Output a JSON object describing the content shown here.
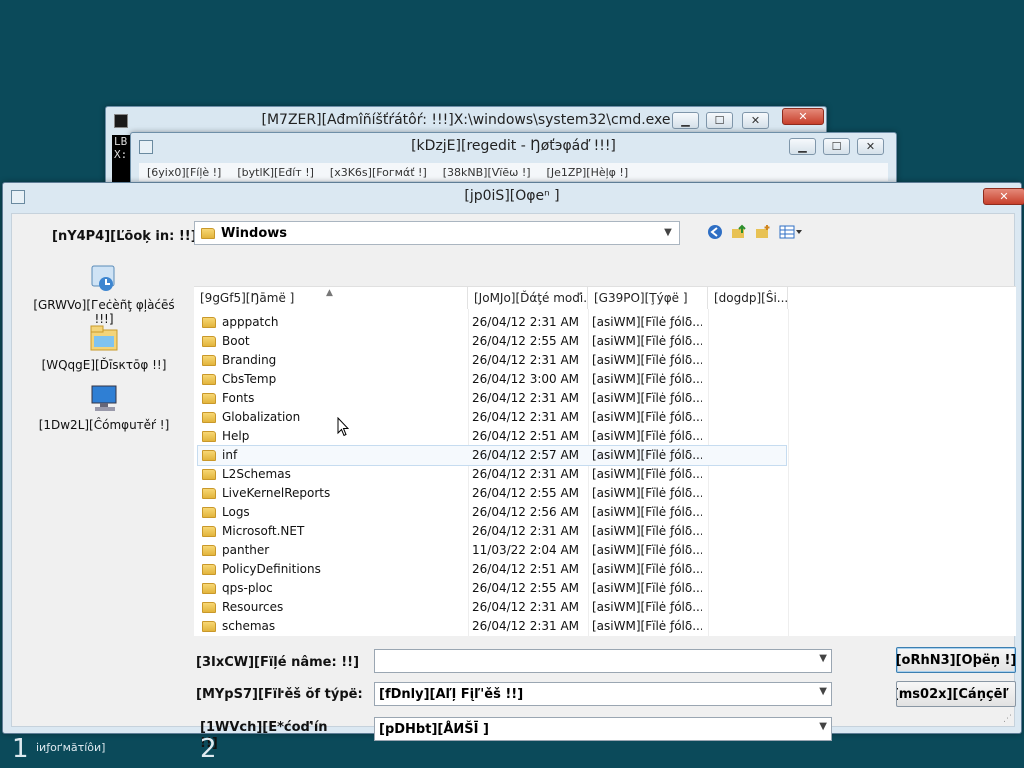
{
  "cmd_window": {
    "title": "[M7ZER][Ađmîñíšťŕátôŕ:  !!!]X:\\windows\\system32\\cmd.exe",
    "console_text": "LB\nX:"
  },
  "notepad_window": {
    "title": "[kDzjE][regedit - Ŋøťэφáď !!!]",
    "menus": [
      "[6yix0][Fíļè !]",
      "[bytlK][Eđíт !]",
      "[x3K6s][Foгмάť !]",
      "[38kNB][Vïēω !]",
      "[Je1ZP][Hèļφ !]"
    ]
  },
  "open_dialog": {
    "title": "[jp0iS][Öφeⁿ ]",
    "look_in_label": "[nY4P4][Ľōoķ in: !!]",
    "look_in_value": "Windows",
    "places": [
      "[GRWVo][Гeċèñţ φļàćēś !!!]",
      "[WQqgE][Ďīsкτōφ !!]",
      "[1Dw2L][Ĉómφuтěŕ !]"
    ],
    "columns": [
      "[9gGf5][Ŋāmë ]",
      "[JoMJo][Ďάţé moďi...",
      "[G39PO][Ţýφë ]",
      "[dogdp][Ŝi..."
    ],
    "files": [
      {
        "name": "apppatch",
        "date": "26/04/12 2:31 AM",
        "type": "[asiWM][Fïlė ƒólδ..."
      },
      {
        "name": "Boot",
        "date": "26/04/12 2:55 AM",
        "type": "[asiWM][Fïlė ƒólδ..."
      },
      {
        "name": "Branding",
        "date": "26/04/12 2:31 AM",
        "type": "[asiWM][Fïlė ƒólδ..."
      },
      {
        "name": "CbsTemp",
        "date": "26/04/12 3:00 AM",
        "type": "[asiWM][Fïlė ƒólδ..."
      },
      {
        "name": "Fonts",
        "date": "26/04/12 2:31 AM",
        "type": "[asiWM][Fïlė ƒólδ..."
      },
      {
        "name": "Globalization",
        "date": "26/04/12 2:31 AM",
        "type": "[asiWM][Fïlė ƒólδ..."
      },
      {
        "name": "Help",
        "date": "26/04/12 2:51 AM",
        "type": "[asiWM][Fïlė ƒólδ..."
      },
      {
        "name": "inf",
        "date": "26/04/12 2:57 AM",
        "type": "[asiWM][Fïlė ƒólδ..."
      },
      {
        "name": "L2Schemas",
        "date": "26/04/12 2:31 AM",
        "type": "[asiWM][Fïlė ƒólδ..."
      },
      {
        "name": "LiveKernelReports",
        "date": "26/04/12 2:55 AM",
        "type": "[asiWM][Fïlė ƒólδ..."
      },
      {
        "name": "Logs",
        "date": "26/04/12 2:56 AM",
        "type": "[asiWM][Fïlė ƒólδ..."
      },
      {
        "name": "Microsoft.NET",
        "date": "26/04/12 2:31 AM",
        "type": "[asiWM][Fïlė ƒólδ..."
      },
      {
        "name": "panther",
        "date": "11/03/22 2:04 AM",
        "type": "[asiWM][Fïlė ƒólδ..."
      },
      {
        "name": "PolicyDefinitions",
        "date": "26/04/12 2:51 AM",
        "type": "[asiWM][Fïlė ƒólδ..."
      },
      {
        "name": "qps-ploc",
        "date": "26/04/12 2:55 AM",
        "type": "[asiWM][Fïlė ƒólδ..."
      },
      {
        "name": "Resources",
        "date": "26/04/12 2:31 AM",
        "type": "[asiWM][Fïlė ƒólδ..."
      },
      {
        "name": "schemas",
        "date": "26/04/12 2:31 AM",
        "type": "[asiWM][Fïlė ƒólδ..."
      }
    ],
    "file_name_label": "[3IxCW][Fïļé nâme: !!]",
    "file_name_value": "",
    "file_type_label": "[MYpS7][Fïŀěš ŏf týpë:",
    "file_type_value": "[fDnly][Aľļ Fįľ'ěš  !!]",
    "encoding_label": "[1WVch][E*ćoď'ín\n!!]",
    "encoding_value": "[pDHbt][ÅИŠĪ ]",
    "open_button": "[oRhN3][Oþёņ !]",
    "cancel_button": "[ms02x][Cáņçēľ !"
  },
  "desktop": {
    "step1_number": "1",
    "step1_text": "іиƒоґмăτíôи]",
    "step2_number": "2"
  }
}
